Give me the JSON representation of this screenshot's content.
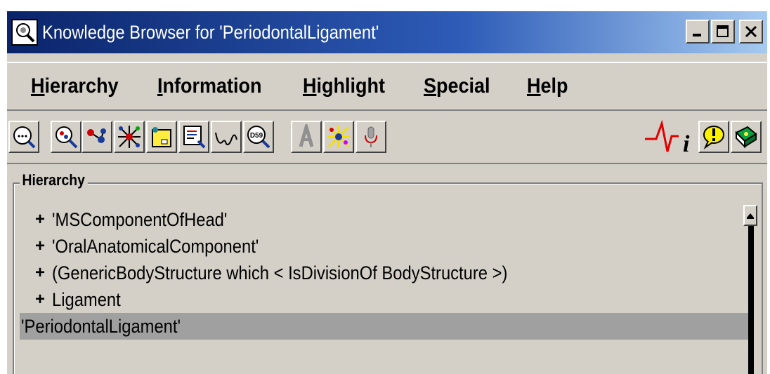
{
  "window": {
    "title": "Knowledge Browser for 'PeriodontalLigament'",
    "controls": [
      "minimize",
      "maximize",
      "close"
    ]
  },
  "menu": {
    "items": [
      {
        "underline": "H",
        "rest": "ierarchy"
      },
      {
        "underline": "I",
        "rest": "nformation"
      },
      {
        "underline": "H",
        "rest": "ighlight"
      },
      {
        "underline": "S",
        "rest": "pecial"
      },
      {
        "underline": "H",
        "rest": "elp"
      }
    ]
  },
  "toolbar": {
    "icons": [
      "speech-bubble-search-icon",
      "node-search-icon",
      "molecule-icon",
      "network-icon",
      "yellow-folder-icon",
      "document-search-icon",
      "link-icon",
      "d59-search-icon",
      "letter-a-icon",
      "explode-icon",
      "microphone-icon",
      "heartbeat-info-icon",
      "exclamation-bubble-icon",
      "book-icon"
    ],
    "d59_label": "D59",
    "info_letter": "i"
  },
  "hierarchy": {
    "title": "Hierarchy",
    "rows": [
      {
        "expander": "+",
        "label": "'MSComponentOfHead'"
      },
      {
        "expander": "+",
        "label": "'OralAnatomicalComponent'"
      },
      {
        "expander": "+",
        "label": "(GenericBodyStructure which < IsDivisionOf BodyStructure >)"
      },
      {
        "expander": "+",
        "label": "Ligament"
      }
    ],
    "selected_label": "'PeriodontalLigament'"
  },
  "colors": {
    "titlebar": "#0a246a",
    "face": "#d4d0c8",
    "selection": "#a0a0a0",
    "heartbeat": "#e00000"
  }
}
